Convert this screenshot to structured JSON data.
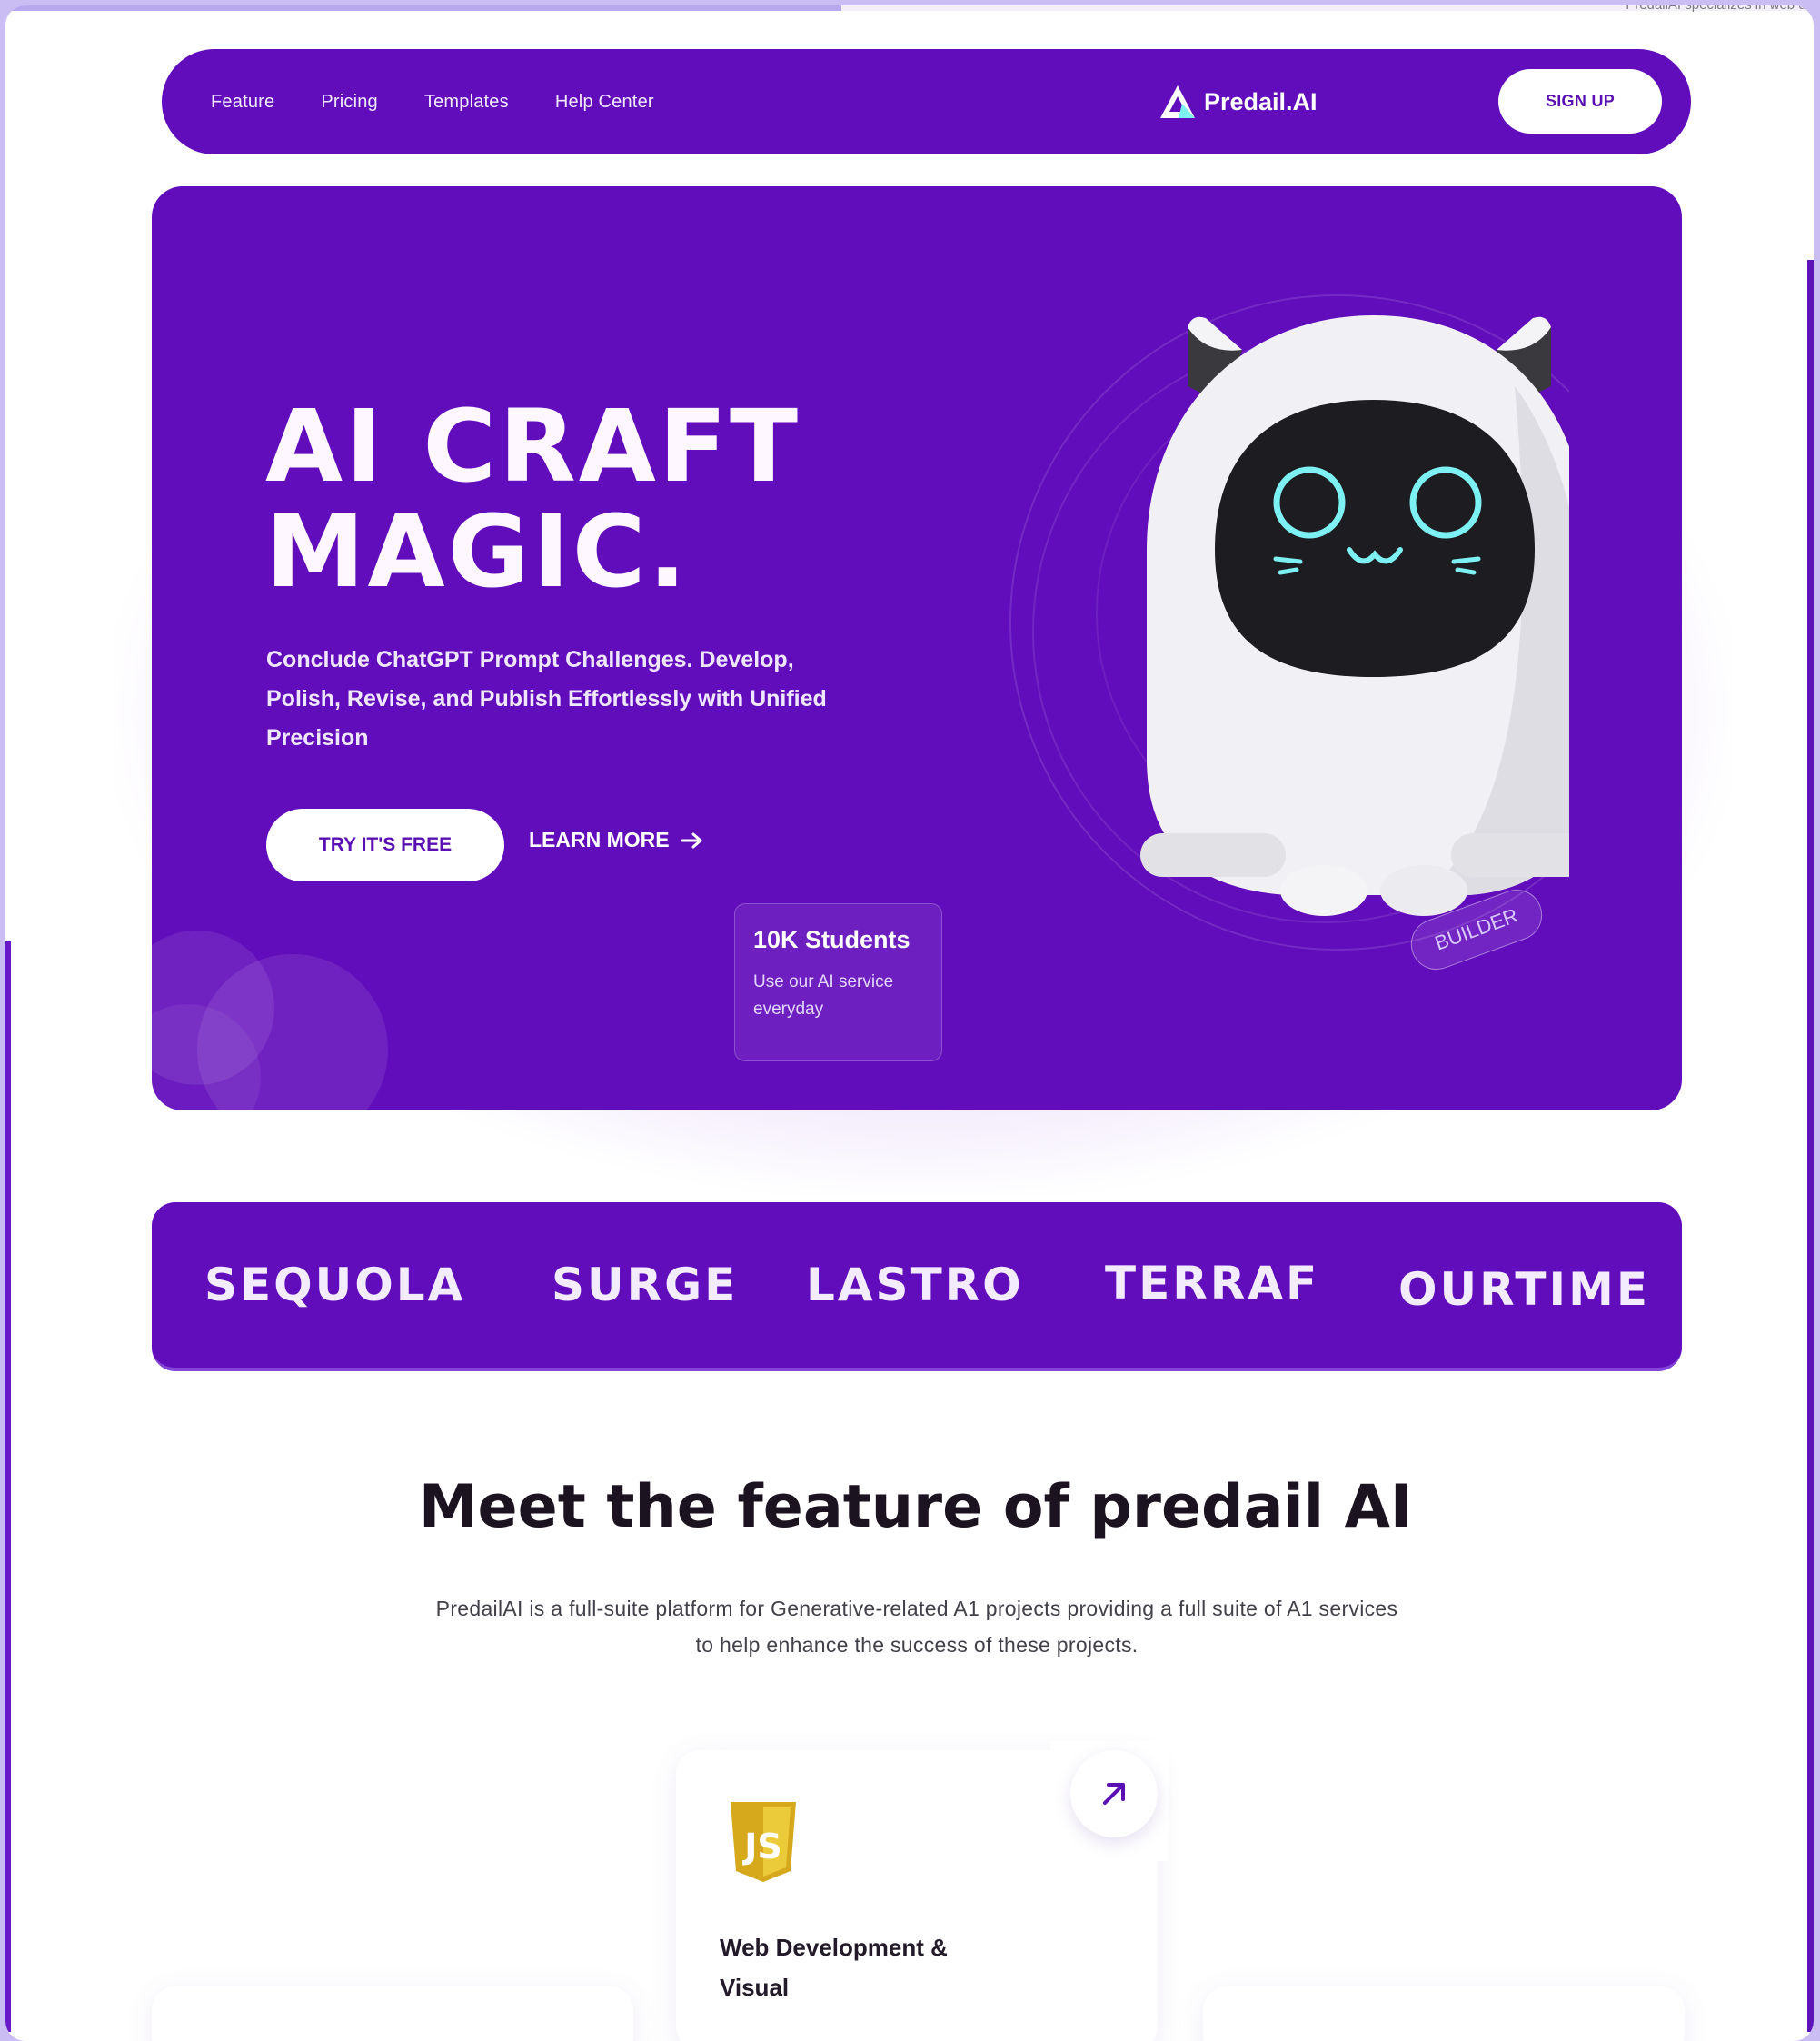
{
  "top_right_snippet": "PredailAI specializes in web de",
  "nav": {
    "links": [
      "Feature",
      "Pricing",
      "Templates",
      "Help Center"
    ],
    "logo_text": "Predail.AI",
    "signup_label": "SIGN UP"
  },
  "hero": {
    "title_line1": "AI CRAFT",
    "title_line2": "MAGIC.",
    "subtitle": "Conclude ChatGPT Prompt Challenges. Develop, Polish, Revise, and Publish Effortlessly with Unified Precision",
    "try_label": "TRY IT'S FREE",
    "learn_label": "LEARN MORE",
    "stat_title": "10K Students",
    "stat_desc": "Use our AI service everyday",
    "badge": "BUILDER"
  },
  "brands": [
    "SEQUOLA",
    "SURGE",
    "LASTRO",
    "TERRAF",
    "OURTIME"
  ],
  "features": {
    "title": "Meet the feature of predail AI",
    "description": "PredailAI is a full-suite platform for Generative-related A1 projects providing a full suite of A1 services to help enhance the success of these projects.",
    "card": {
      "title": "Web Development & Visual",
      "icon": "js-icon"
    }
  },
  "colors": {
    "brand_purple": "#620dbb",
    "accent_cyan": "#7cf0f2",
    "js_yellow": "#e6c02a"
  }
}
